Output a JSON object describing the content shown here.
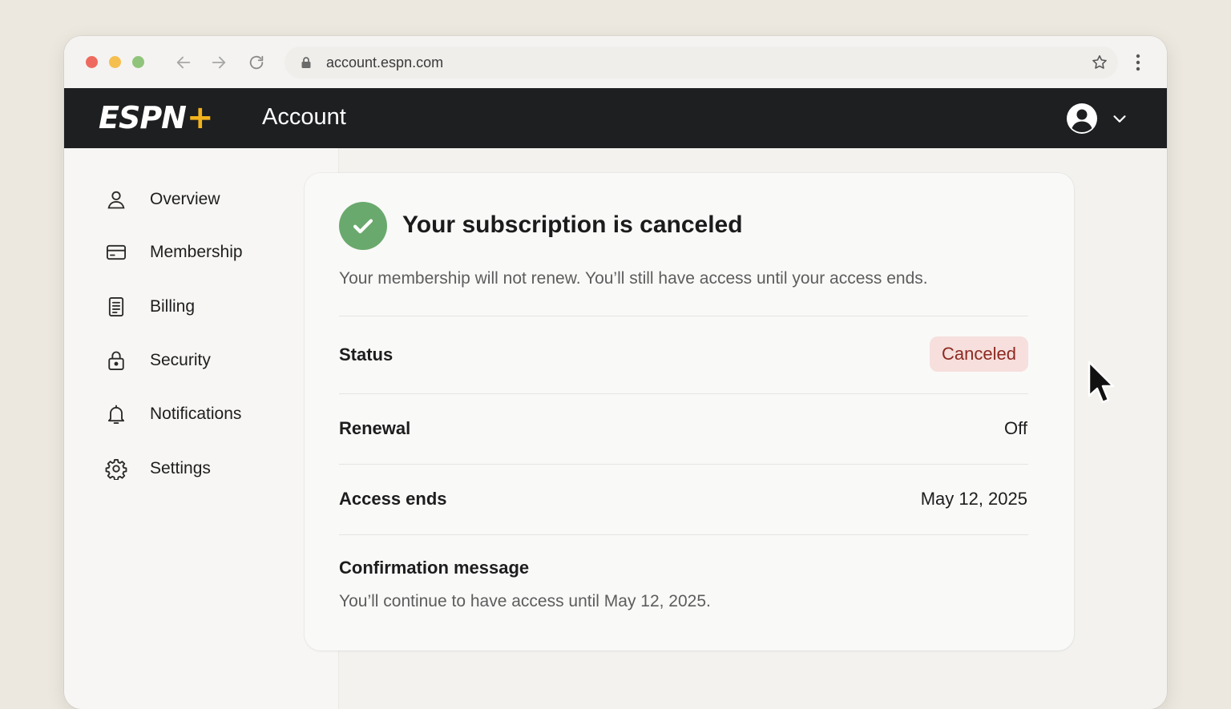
{
  "browser": {
    "url": "account.espn.com"
  },
  "header": {
    "logo_text": "ESPN",
    "logo_plus": "+",
    "title": "Account",
    "profile_icon": "user-circle-icon",
    "dropdown_icon": "chevron-down-icon"
  },
  "sidebar": {
    "items": [
      {
        "label": "Overview",
        "icon": "person-icon"
      },
      {
        "label": "Membership",
        "icon": "card-icon"
      },
      {
        "label": "Billing",
        "icon": "receipt-icon"
      },
      {
        "label": "Security",
        "icon": "lock-icon"
      },
      {
        "label": "Notifications",
        "icon": "bell-icon"
      },
      {
        "label": "Settings",
        "icon": "gear-icon"
      }
    ]
  },
  "card": {
    "title": "Your subscription is canceled",
    "subtitle": "Your membership will not renew. You’ll still have access until your access ends.",
    "rows": [
      {
        "label": "Status",
        "value": "Canceled"
      },
      {
        "label": "Renewal",
        "value": "Off"
      },
      {
        "label": "Access ends",
        "value": "May 12, 2025"
      }
    ],
    "confirmation_label": "Confirmation message",
    "confirmation_text": "You’ll continue to have access until May 12, 2025."
  },
  "colors": {
    "header_bg": "#1e1f21",
    "accent": "#f2b21c",
    "success": "#6aa96d",
    "badge_bg": "#f6dfdc",
    "badge_text": "#8c2a22"
  }
}
